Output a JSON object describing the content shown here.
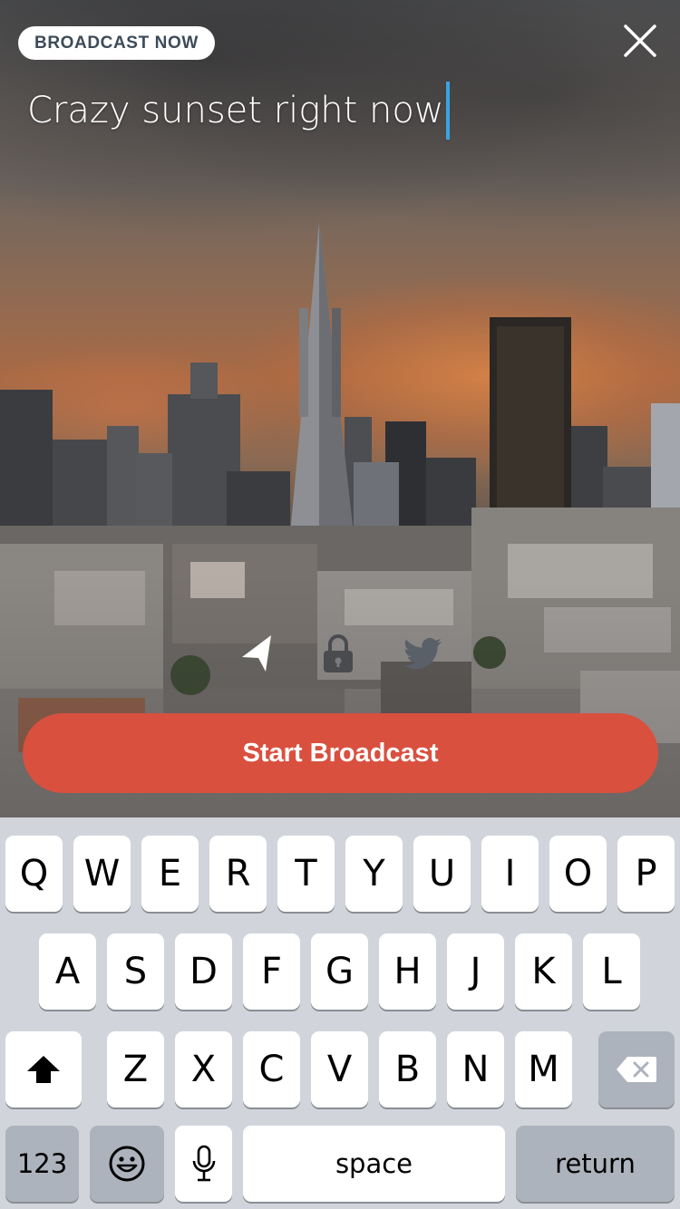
{
  "header": {
    "pill_label": "BROADCAST NOW",
    "close_icon": "close-icon"
  },
  "title_input": {
    "value": "Crazy sunset right now"
  },
  "options": [
    {
      "icon": "location-arrow-icon",
      "active": true
    },
    {
      "icon": "lock-icon",
      "active": false
    },
    {
      "icon": "twitter-bird-icon",
      "active": false
    }
  ],
  "start_button": {
    "label": "Start Broadcast",
    "color": "#d9503f"
  },
  "keyboard": {
    "row1": [
      "Q",
      "W",
      "E",
      "R",
      "T",
      "Y",
      "U",
      "I",
      "O",
      "P"
    ],
    "row2": [
      "A",
      "S",
      "D",
      "F",
      "G",
      "H",
      "J",
      "K",
      "L"
    ],
    "row3": [
      "Z",
      "X",
      "C",
      "V",
      "B",
      "N",
      "M"
    ],
    "numbers_label": "123",
    "space_label": "space",
    "return_label": "return",
    "shift_icon": "shift-icon",
    "backspace_icon": "backspace-icon",
    "emoji_icon": "emoji-icon",
    "mic_icon": "microphone-icon"
  },
  "colors": {
    "accent": "#d9503f",
    "caret": "#3aa3e3",
    "keyboard_bg": "#d1d5db"
  }
}
